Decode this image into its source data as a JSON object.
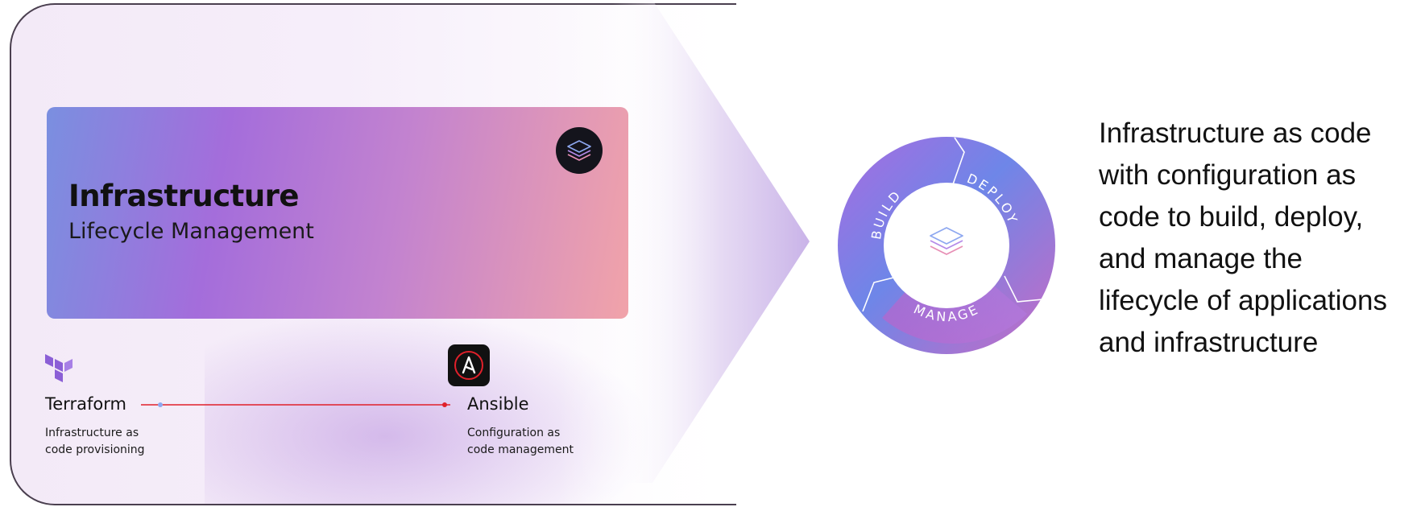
{
  "hero": {
    "title": "Infrastructure",
    "subtitle": "Lifecycle Management",
    "icon": "layers-icon"
  },
  "tools": [
    {
      "name": "Terraform",
      "description": [
        "Infrastructure as",
        "code provisioning"
      ],
      "icon": "terraform-logo"
    },
    {
      "name": "Ansible",
      "description": [
        "Configuration as",
        "code management"
      ],
      "icon": "ansible-logo"
    }
  ],
  "cycle": {
    "segments": [
      "BUILD",
      "DEPLOY",
      "MANAGE"
    ],
    "center_icon": "layers-icon"
  },
  "summary": {
    "lines": [
      "Infrastructure as code",
      "with configuration as",
      "code to build, deploy,",
      "and manage the",
      "lifecycle of applications",
      "and infrastructure"
    ]
  },
  "colors": {
    "card_gradient": [
      "#7a8fe0",
      "#a46ddb",
      "#c383cf",
      "#f1a3a9"
    ],
    "connector": "#e0202a",
    "ring_build": "#9b6fe0",
    "ring_deploy": "#5a8fe6",
    "ring_manage": "#c16ac8"
  }
}
